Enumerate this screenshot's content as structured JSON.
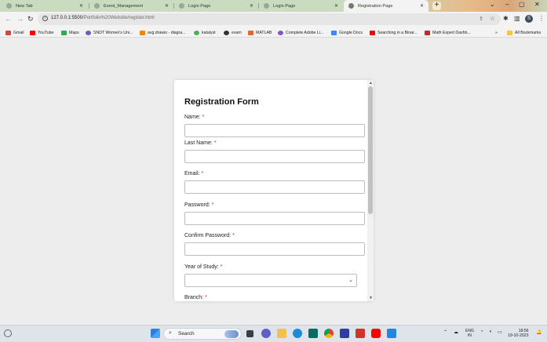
{
  "browser": {
    "tabs": [
      {
        "label": "New Tab"
      },
      {
        "label": "Event_Management"
      },
      {
        "label": "Login Page"
      },
      {
        "label": "Login Page"
      },
      {
        "label": "Registration Page"
      }
    ],
    "new_tab_label": "+",
    "address": {
      "host": "127.0.0.1:5500",
      "path": "/Portfolio%20Website/register.html"
    },
    "profile_initial": "S",
    "bookmarks": [
      {
        "label": "Gmail",
        "color": "#d44638"
      },
      {
        "label": "YouTube",
        "color": "#ff0000"
      },
      {
        "label": "Maps",
        "color": "#34a853"
      },
      {
        "label": "SNDT Women's Uni...",
        "color": "#6b5fb5"
      },
      {
        "label": "avg.drawio - diagra...",
        "color": "#f08705"
      },
      {
        "label": "katalyst",
        "color": "#4caf50"
      },
      {
        "label": "exam",
        "color": "#333333"
      },
      {
        "label": "MATLAB",
        "color": "#e16737"
      },
      {
        "label": "Complete Adobe Li...",
        "color": "#7e57c2"
      },
      {
        "label": "Google Docs",
        "color": "#4285f4"
      },
      {
        "label": "Searching in a Binar...",
        "color": "#ff0000"
      },
      {
        "label": "Math Expert Dashb...",
        "color": "#c62828"
      }
    ],
    "bookmarks_overflow": "»",
    "all_bookmarks": "All Bookmarks"
  },
  "form": {
    "title": "Registration Form",
    "required_marker": "*",
    "fields": [
      {
        "label": "Name:",
        "value": ""
      },
      {
        "label": "Last Name:",
        "value": ""
      },
      {
        "label": "Email:",
        "value": ""
      },
      {
        "label": "Password:",
        "value": ""
      },
      {
        "label": "Confirm Password:",
        "value": ""
      }
    ],
    "year_of_study": {
      "label": "Year of Study:",
      "selected": ""
    },
    "branch": {
      "label": "Branch:"
    }
  },
  "taskbar": {
    "search_label": "Search",
    "language": {
      "line1": "ENG",
      "line2": "IN"
    },
    "time": "18:56",
    "date": "19-10-2023"
  }
}
